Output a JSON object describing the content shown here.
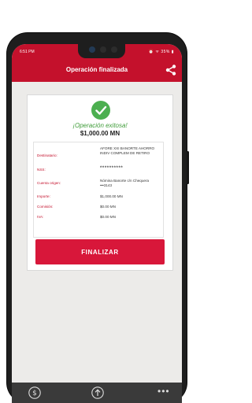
{
  "status_bar": {
    "time": "6:51 PM",
    "icons": "⏰ ᯤ 35% ▮"
  },
  "header": {
    "title": "Operación finalizada"
  },
  "success": {
    "message": "¡Operación exitosa!",
    "amount": "$1,000.00 MN"
  },
  "details": [
    {
      "label": "Destinatario:",
      "value": "AFORE XXI BANORTE AHORRO INDIV COMPLEM DE RETIRO"
    },
    {
      "label": "NSS:",
      "value": "**********"
    },
    {
      "label": "Cuenta origen:",
      "value": "Nómina Banorte c/n Chequera •••3143"
    },
    {
      "label": "Importe:",
      "value": "$1,000.00 MN"
    },
    {
      "label": "Comisión:",
      "value": "$0.00 MN"
    },
    {
      "label": "IVA:",
      "value": "$0.00 MN"
    }
  ],
  "actions": {
    "finalize_label": "FINALIZAR"
  },
  "bottom_nav": {
    "items": [
      "dollar-icon",
      "upload-icon",
      "more-icon"
    ]
  },
  "colors": {
    "brand_red": "#c4112c",
    "success_green": "#3f9c39"
  }
}
